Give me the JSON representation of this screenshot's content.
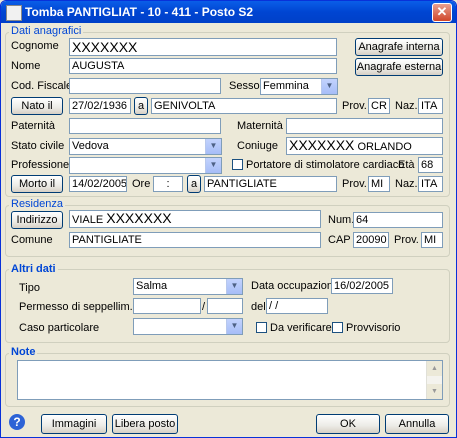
{
  "window": {
    "title": "Tomba PANTIGLIAT - 10 - 411 - Posto S2",
    "close": "✕"
  },
  "anagrafici": {
    "group_label": "Dati anagrafici",
    "cognome_label": "Cognome",
    "cognome_value": "XXXXXXX",
    "nome_label": "Nome",
    "nome_value": "AUGUSTA",
    "cod_fiscale_label": "Cod. Fiscale",
    "cod_fiscale_value": "",
    "sesso_label": "Sesso",
    "sesso_value": "Femmina",
    "anagrafe_interna": "Anagrafe interna",
    "anagrafe_esterna": "Anagrafe esterna",
    "nato_button": "Nato il",
    "nato_data": "27/02/1936",
    "nato_a_button": "a",
    "nato_luogo": "GENIVOLTA",
    "prov_label": "Prov.",
    "nato_prov": "CR",
    "naz_label": "Naz.",
    "nato_naz": "ITA",
    "paternita_label": "Paternità",
    "paternita_value": "",
    "maternita_label": "Maternità",
    "maternita_value": "",
    "stato_civile_label": "Stato civile",
    "stato_civile_value": "Vedova",
    "coniuge_label": "Coniuge",
    "coniuge_cognome": "XXXXXXX",
    "coniuge_nome": "ORLANDO",
    "professione_label": "Professione",
    "professione_value": "",
    "stimolatore_label": "Portatore di stimolatore cardiaco",
    "eta_label": "Età",
    "eta_value": "68",
    "morto_button": "Morto il",
    "morto_data": "14/02/2005",
    "ore_label": "Ore",
    "ore_value": ":",
    "morto_a_button": "a",
    "morto_luogo": "PANTIGLIATE",
    "morto_prov": "MI",
    "morto_naz": "ITA"
  },
  "residenza": {
    "group_label": "Residenza",
    "indirizzo_button": "Indirizzo",
    "indirizzo_via": "VIALE",
    "indirizzo_nome": "XXXXXXX",
    "num_label": "Num.",
    "num_value": "64",
    "comune_label": "Comune",
    "comune_value": "PANTIGLIATE",
    "cap_label": "CAP",
    "cap_value": "20090",
    "prov_label": "Prov.",
    "prov_value": "MI"
  },
  "altri": {
    "group_label": "Altri dati",
    "tipo_label": "Tipo",
    "tipo_value": "Salma",
    "data_occupazione_label": "Data occupazione",
    "data_occupazione_value": "16/02/2005",
    "permesso_label": "Permesso di seppellim. N.",
    "permesso_n": "",
    "permesso_slash": "/",
    "permesso_anno": "",
    "del_label": "del",
    "del_value": " /  /",
    "caso_label": "Caso particolare",
    "caso_value": "",
    "da_verificare": "Da verificare",
    "provvisorio": "Provvisorio"
  },
  "note": {
    "group_label": "Note",
    "value": ""
  },
  "footer": {
    "help": "?",
    "immagini": "Immagini",
    "libera_posto": "Libera posto",
    "ok": "OK",
    "annulla": "Annulla"
  }
}
